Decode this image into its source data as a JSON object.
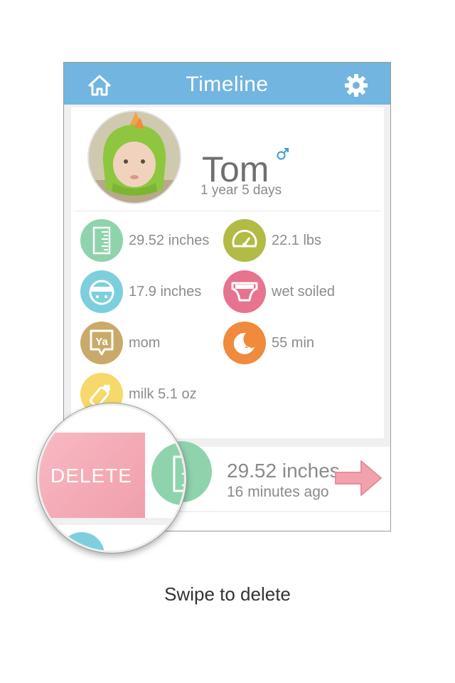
{
  "header": {
    "title": "Timeline",
    "home_icon": "home-icon",
    "settings_icon": "gear-icon"
  },
  "profile": {
    "name": "Tom",
    "gender_symbol": "♂",
    "age": "1 year 5 days"
  },
  "stats": [
    {
      "icon": "ruler-icon",
      "color": "#8fd3ad",
      "value": "29.52 inches"
    },
    {
      "icon": "scale-icon",
      "color": "#b2bb45",
      "value": "22.1 lbs"
    },
    {
      "icon": "head-measure-icon",
      "color": "#7dcfdd",
      "value": "17.9 inches"
    },
    {
      "icon": "diaper-icon",
      "color": "#e7738e",
      "value": "wet soiled"
    },
    {
      "icon": "speech-bubble-icon",
      "color": "#c9aa6a",
      "value": "mom"
    },
    {
      "icon": "sleep-moon-icon",
      "color": "#f08a3c",
      "value": "55 min"
    },
    {
      "icon": "bottle-icon",
      "color": "#f6d96a",
      "value": "milk 5.1 oz"
    }
  ],
  "timeline_row": {
    "value": "29.52 inches",
    "time": "16 minutes ago",
    "arrow_color": "#f2a2ad"
  },
  "delete_label": "DELETE",
  "caption": "Swipe to delete"
}
